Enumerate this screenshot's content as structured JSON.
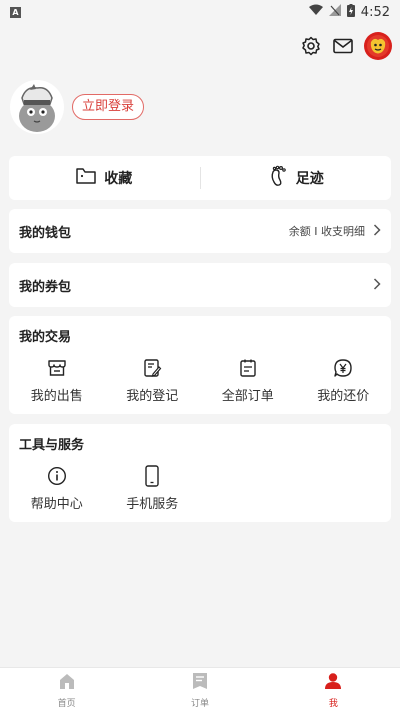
{
  "statusbar": {
    "app_badge": "A",
    "time": "4:52"
  },
  "profile": {
    "login_label": "立即登录"
  },
  "favorites": {
    "collect_label": "收藏",
    "footprint_label": "足迹"
  },
  "wallet": {
    "title": "我的钱包",
    "detail": "余额 I 收支明细"
  },
  "coupons": {
    "title": "我的券包"
  },
  "trade": {
    "title": "我的交易",
    "items": [
      {
        "label": "我的出售",
        "icon": "store-icon"
      },
      {
        "label": "我的登记",
        "icon": "register-icon"
      },
      {
        "label": "全部订单",
        "icon": "orders-icon"
      },
      {
        "label": "我的还价",
        "icon": "yen-icon"
      }
    ]
  },
  "tools": {
    "title": "工具与服务",
    "items": [
      {
        "label": "帮助中心",
        "icon": "info-icon"
      },
      {
        "label": "手机服务",
        "icon": "phone-icon"
      }
    ]
  },
  "tabbar": {
    "tabs": [
      {
        "label": "首页",
        "icon": "home-icon"
      },
      {
        "label": "订单",
        "icon": "order-icon"
      },
      {
        "label": "我",
        "icon": "user-icon"
      }
    ],
    "active_color": "#d8201c"
  },
  "colors": {
    "accent": "#d8201c",
    "background": "#f4f4f4"
  }
}
